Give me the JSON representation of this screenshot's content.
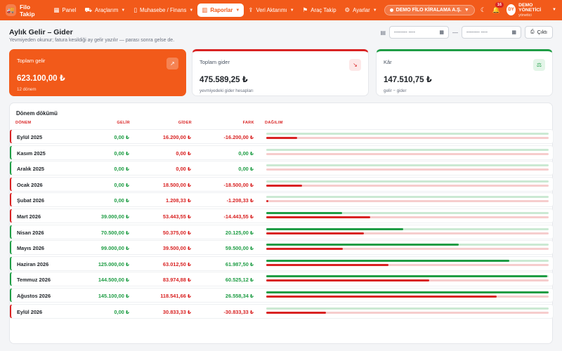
{
  "nav": {
    "brand": "Filo Takip",
    "items": [
      {
        "label": "Panel",
        "icon": "grid-icon",
        "dropdown": false,
        "active": false
      },
      {
        "label": "Araçlarım",
        "icon": "car-icon",
        "dropdown": true,
        "active": false
      },
      {
        "label": "Muhasebe / Finans",
        "icon": "book-icon",
        "dropdown": true,
        "active": false
      },
      {
        "label": "Raporlar",
        "icon": "chart-icon",
        "dropdown": true,
        "active": true
      },
      {
        "label": "Veri Aktarımı",
        "icon": "upload-icon",
        "dropdown": true,
        "active": false
      },
      {
        "label": "Araç Takip",
        "icon": "route-icon",
        "dropdown": false,
        "active": false
      },
      {
        "label": "Ayarlar",
        "icon": "gear-icon",
        "dropdown": true,
        "active": false
      }
    ],
    "company": "DEMO FİLO KİRALAMA A.Ş.",
    "notifications": "16",
    "user": {
      "initials": "DY",
      "name": "DEMO YÖNETİCİ",
      "role": "yönetici"
    }
  },
  "page": {
    "title": "Aylık Gelir – Gider",
    "subtitle": "Yevmiyeden okunur; fatura kesildiği ay gelir yazılır — parası sonra gelse de.",
    "date_placeholder": "-------- ----",
    "separator": "—",
    "print_label": "Çıktı"
  },
  "cards": [
    {
      "label": "Toplam gelir",
      "value": "623.100,00 ₺",
      "sub": "12 dönem",
      "icon": "trending-up-icon"
    },
    {
      "label": "Toplam gider",
      "value": "475.589,25 ₺",
      "sub": "yevmiyedeki gider hesapları",
      "icon": "trending-down-icon"
    },
    {
      "label": "Kâr",
      "value": "147.510,75 ₺",
      "sub": "gelir − gider",
      "icon": "scale-icon"
    }
  ],
  "table": {
    "title": "Dönem dökümü",
    "headers": {
      "period": "DÖNEM",
      "income": "GELİR",
      "expense": "GİDER",
      "diff": "FARK",
      "distribution": "DAĞILIM"
    },
    "rows": [
      {
        "period": "Eylül 2025",
        "income": "0,00 ₺",
        "expense": "16.200,00 ₺",
        "diff": "-16.200,00 ₺",
        "sign": "neg",
        "income_share": 0.0,
        "expense_share": 0.11
      },
      {
        "period": "Kasım 2025",
        "income": "0,00 ₺",
        "expense": "0,00 ₺",
        "diff": "0,00 ₺",
        "sign": "pos",
        "income_share": 0.0,
        "expense_share": 0.0
      },
      {
        "period": "Aralık 2025",
        "income": "0,00 ₺",
        "expense": "0,00 ₺",
        "diff": "0,00 ₺",
        "sign": "pos",
        "income_share": 0.0,
        "expense_share": 0.0
      },
      {
        "period": "Ocak 2026",
        "income": "0,00 ₺",
        "expense": "18.500,00 ₺",
        "diff": "-18.500,00 ₺",
        "sign": "neg",
        "income_share": 0.0,
        "expense_share": 0.127
      },
      {
        "period": "Şubat 2026",
        "income": "0,00 ₺",
        "expense": "1.208,33 ₺",
        "diff": "-1.208,33 ₺",
        "sign": "neg",
        "income_share": 0.0,
        "expense_share": 0.008
      },
      {
        "period": "Mart 2026",
        "income": "39.000,00 ₺",
        "expense": "53.443,55 ₺",
        "diff": "-14.443,55 ₺",
        "sign": "neg",
        "income_share": 0.268,
        "expense_share": 0.368
      },
      {
        "period": "Nisan 2026",
        "income": "70.500,00 ₺",
        "expense": "50.375,00 ₺",
        "diff": "20.125,00 ₺",
        "sign": "pos",
        "income_share": 0.485,
        "expense_share": 0.346
      },
      {
        "period": "Mayıs 2026",
        "income": "99.000,00 ₺",
        "expense": "39.500,00 ₺",
        "diff": "59.500,00 ₺",
        "sign": "pos",
        "income_share": 0.681,
        "expense_share": 0.272
      },
      {
        "period": "Haziran 2026",
        "income": "125.000,00 ₺",
        "expense": "63.012,50 ₺",
        "diff": "61.987,50 ₺",
        "sign": "pos",
        "income_share": 0.86,
        "expense_share": 0.433
      },
      {
        "period": "Temmuz 2026",
        "income": "144.500,00 ₺",
        "expense": "83.974,88 ₺",
        "diff": "60.525,12 ₺",
        "sign": "pos",
        "income_share": 0.994,
        "expense_share": 0.578
      },
      {
        "period": "Ağustos 2026",
        "income": "145.100,00 ₺",
        "expense": "118.541,66 ₺",
        "diff": "26.558,34 ₺",
        "sign": "pos",
        "income_share": 1.0,
        "expense_share": 0.815
      },
      {
        "period": "Eylül 2026",
        "income": "0,00 ₺",
        "expense": "30.833,33 ₺",
        "diff": "-30.833,33 ₺",
        "sign": "neg",
        "income_share": 0.0,
        "expense_share": 0.212
      }
    ]
  },
  "colors": {
    "accent": "#f25a1a",
    "income": "#1f9d45",
    "expense": "#d92323"
  }
}
